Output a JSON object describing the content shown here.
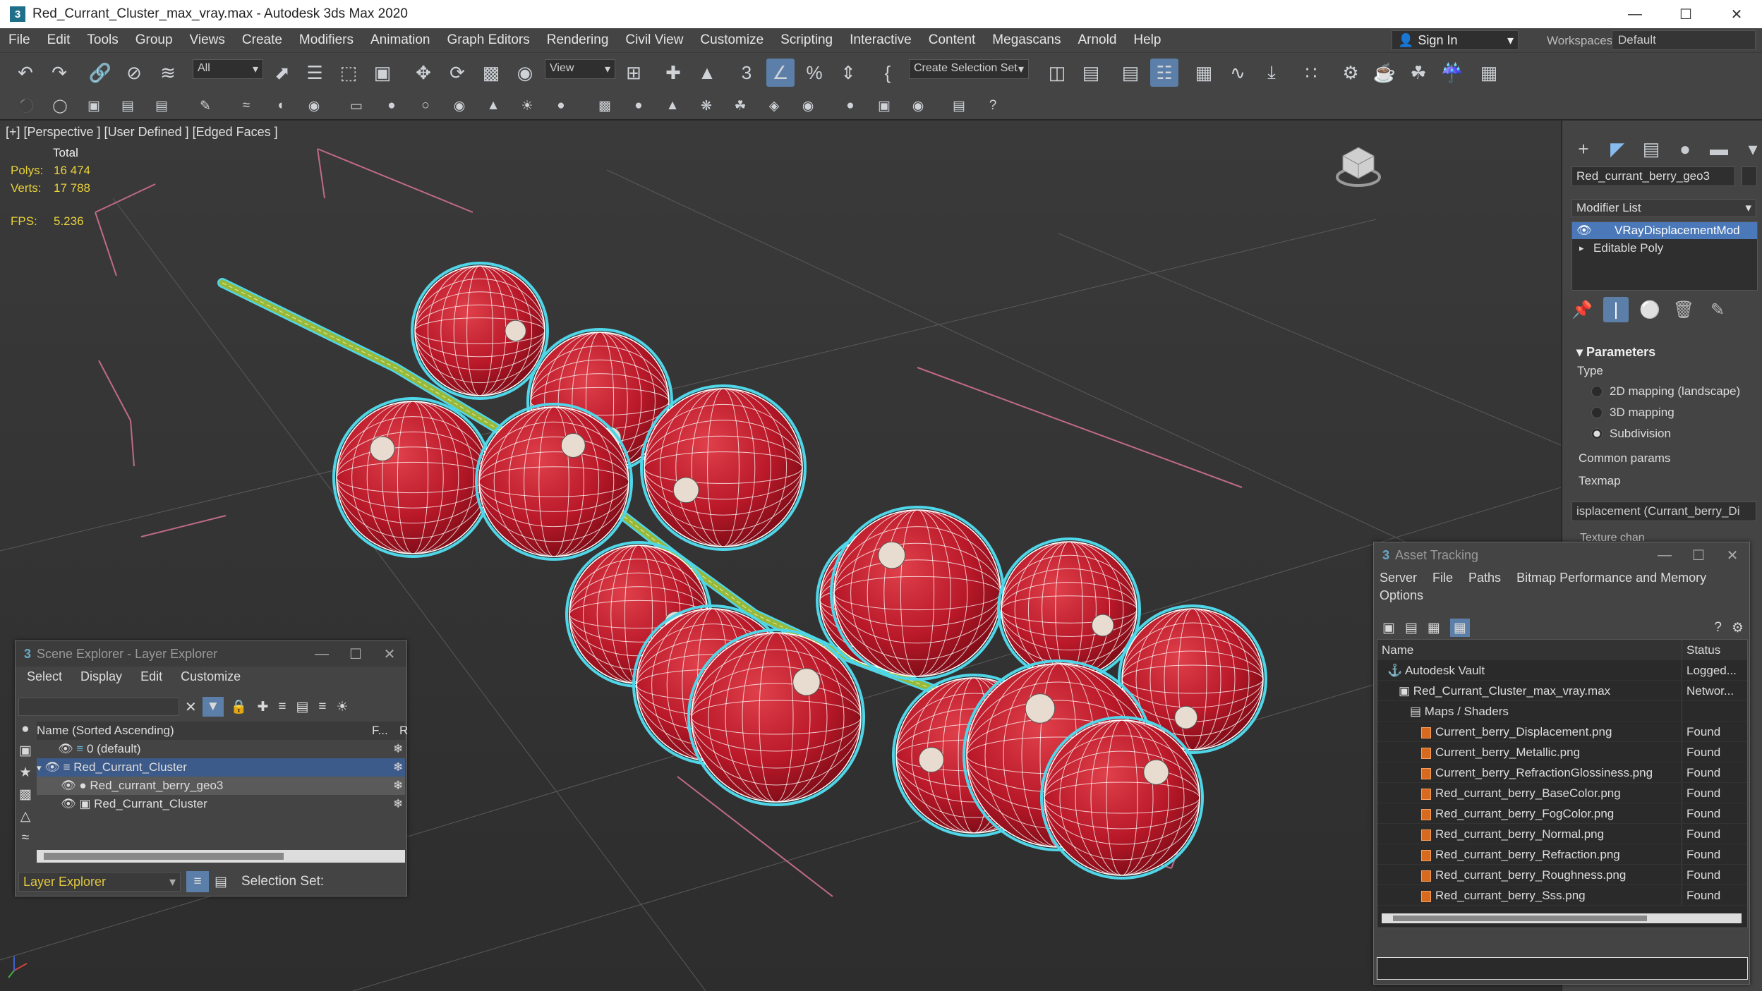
{
  "window": {
    "title": "Red_Currant_Cluster_max_vray.max - Autodesk 3ds Max 2020",
    "logo": "3"
  },
  "menus": [
    "File",
    "Edit",
    "Tools",
    "Group",
    "Views",
    "Create",
    "Modifiers",
    "Animation",
    "Graph Editors",
    "Rendering",
    "Civil View",
    "Customize",
    "Scripting",
    "Interactive",
    "Content",
    "Megascans",
    "Arnold",
    "Help"
  ],
  "signin": "Sign In",
  "workspaces": {
    "label": "Workspaces:",
    "value": "Default"
  },
  "toolbar": {
    "filter": "All",
    "refcoord": "View",
    "selset": "Create Selection Set"
  },
  "viewport": {
    "label": "[+] [Perspective ] [User Defined ] [Edged Faces ]",
    "stats": {
      "total": "Total",
      "polys_label": "Polys:",
      "polys": "16 474",
      "verts_label": "Verts:",
      "verts": "17 788",
      "fps_label": "FPS:",
      "fps": "5.236"
    }
  },
  "command_panel": {
    "object_name": "Red_currant_berry_geo3",
    "modifier_list": "Modifier List",
    "stack": [
      "VRayDisplacementMod",
      "Editable Poly"
    ],
    "params_title": "Parameters",
    "type_label": "Type",
    "types": [
      "2D mapping (landscape)",
      "3D mapping",
      "Subdivision"
    ],
    "selected_type": "Subdivision",
    "common": "Common params",
    "texmap_label": "Texmap",
    "texmap_value": "isplacement (Currant_berry_Di",
    "texture_chan": "Texture chan"
  },
  "scene_explorer": {
    "title": "Scene Explorer - Layer Explorer",
    "menu": [
      "Select",
      "Display",
      "Edit",
      "Customize"
    ],
    "col_name": "Name (Sorted Ascending)",
    "col_f": "F...",
    "col_r": "R",
    "rows": [
      "0 (default)",
      "Red_Currant_Cluster",
      "Red_currant_berry_geo3",
      "Red_Currant_Cluster"
    ],
    "footer_select": "Layer Explorer",
    "selection_set": "Selection Set:"
  },
  "asset_tracking": {
    "title": "Asset Tracking",
    "menu": [
      "Server",
      "File",
      "Paths",
      "Bitmap Performance and Memory"
    ],
    "menu2": "Options",
    "col_name": "Name",
    "col_status": "Status",
    "rows": [
      {
        "name": "Autodesk Vault",
        "status": "Logged..."
      },
      {
        "name": "Red_Currant_Cluster_max_vray.max",
        "status": "Networ..."
      },
      {
        "name": "Maps / Shaders",
        "status": ""
      },
      {
        "name": "Current_berry_Displacement.png",
        "status": "Found"
      },
      {
        "name": "Current_berry_Metallic.png",
        "status": "Found"
      },
      {
        "name": "Current_berry_RefractionGlossiness.png",
        "status": "Found"
      },
      {
        "name": "Red_currant_berry_BaseColor.png",
        "status": "Found"
      },
      {
        "name": "Red_currant_berry_FogColor.png",
        "status": "Found"
      },
      {
        "name": "Red_currant_berry_Normal.png",
        "status": "Found"
      },
      {
        "name": "Red_currant_berry_Refraction.png",
        "status": "Found"
      },
      {
        "name": "Red_currant_berry_Roughness.png",
        "status": "Found"
      },
      {
        "name": "Red_currant_berry_Sss.png",
        "status": "Found"
      }
    ]
  },
  "colors": {
    "accent": "#5b7fa8",
    "berry": "#c0202e",
    "wire": "#ffffff",
    "selection_outline": "#4fd6e8",
    "stats": "#e8d23a"
  }
}
